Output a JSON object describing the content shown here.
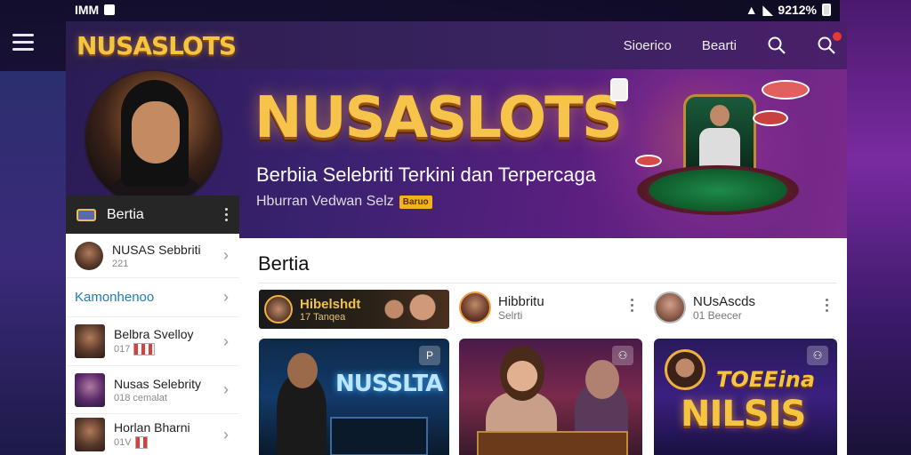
{
  "status_bar": {
    "left_text": "IMM",
    "right_text": "9212%"
  },
  "header": {
    "logo": "NUSASLOTS",
    "nav": [
      {
        "label": "Sioerico"
      },
      {
        "label": "Bearti"
      }
    ]
  },
  "hero": {
    "title": "NUSASLOTS",
    "subtitle": "Berbiia Selebriti Terkini dan Terpercaga",
    "tagline": "Hburran Vedwan Selz",
    "tag": "Baruo"
  },
  "sidebar": {
    "header_label": "Bertia",
    "items": [
      {
        "name": "NUSAS Sebbriti",
        "meta": "221",
        "type": "avatar"
      },
      {
        "name": "Kamonhenoo",
        "type": "link"
      },
      {
        "name": "Belbra Svelloy",
        "meta": "017",
        "type": "flag"
      },
      {
        "name": "Nusas Selebrity",
        "meta": "018 cemalat",
        "type": "plain"
      },
      {
        "name": "Horlan Bharni",
        "meta": "01V",
        "type": "flag"
      }
    ]
  },
  "content": {
    "title": "Bertia",
    "featured": {
      "name": "Hibelshdt",
      "meta": "17 Tanqea"
    },
    "users": [
      {
        "name": "Hibbritu",
        "meta": "Selrti"
      },
      {
        "name": "NUsAscds",
        "meta": "01 Beecer"
      }
    ],
    "thumbs": [
      {
        "text": "NUSSLTA",
        "badge": "P"
      },
      {
        "text": "",
        "badge": "⚇"
      },
      {
        "text_small": "TOEEina",
        "text_big": "NILSIS",
        "badge": "⚇"
      }
    ]
  },
  "colors": {
    "accent_gold": "#f5c542",
    "link_blue": "#1e7ab8",
    "panel_dark": "#262626"
  }
}
